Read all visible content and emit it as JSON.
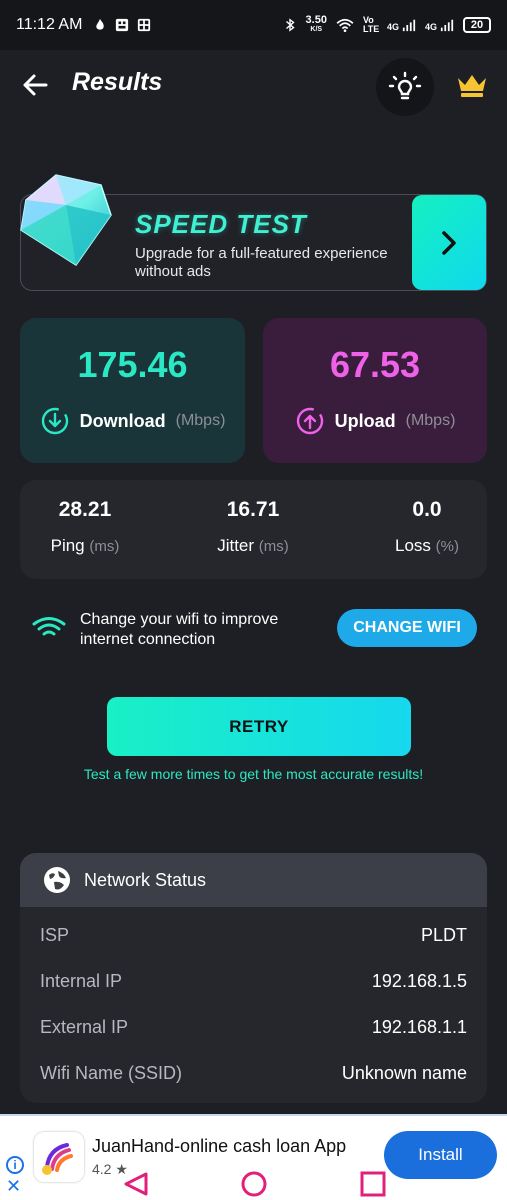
{
  "status_bar": {
    "time": "11:12 AM",
    "speed_value": "3.50",
    "speed_unit": "K/S",
    "volte": "Vo LTE",
    "net1": "4G",
    "net2": "4G",
    "battery": "20"
  },
  "header": {
    "title": "Results"
  },
  "promo": {
    "title": "SPEED TEST",
    "subtitle": "Upgrade for a full-featured experience without ads"
  },
  "download": {
    "value": "175.46",
    "label": "Download",
    "unit": "(Mbps)",
    "color": "#2be8c4"
  },
  "upload": {
    "value": "67.53",
    "label": "Upload",
    "unit": "(Mbps)",
    "color": "#ef61e9"
  },
  "stats": [
    {
      "value": "28.21",
      "label": "Ping",
      "unit": "(ms)"
    },
    {
      "value": "16.71",
      "label": "Jitter",
      "unit": "(ms)"
    },
    {
      "value": "0.0",
      "label": "Loss",
      "unit": "(%)"
    }
  ],
  "wifi_prompt": {
    "text": "Change your wifi to improve internet connection",
    "button": "CHANGE WIFI"
  },
  "retry": {
    "label": "RETRY",
    "hint": "Test a few more times to get the most accurate results!"
  },
  "network_status": {
    "title": "Network Status",
    "rows": [
      {
        "key": "ISP",
        "value": "PLDT"
      },
      {
        "key": "Internal IP",
        "value": "192.168.1.5"
      },
      {
        "key": "External IP",
        "value": "192.168.1.1"
      },
      {
        "key": "Wifi Name (SSID)",
        "value": "Unknown name"
      }
    ]
  },
  "ad": {
    "title": "JuanHand-online cash loan App",
    "rating": "4.2 ★",
    "install": "Install",
    "info": "i",
    "close": "✕"
  }
}
